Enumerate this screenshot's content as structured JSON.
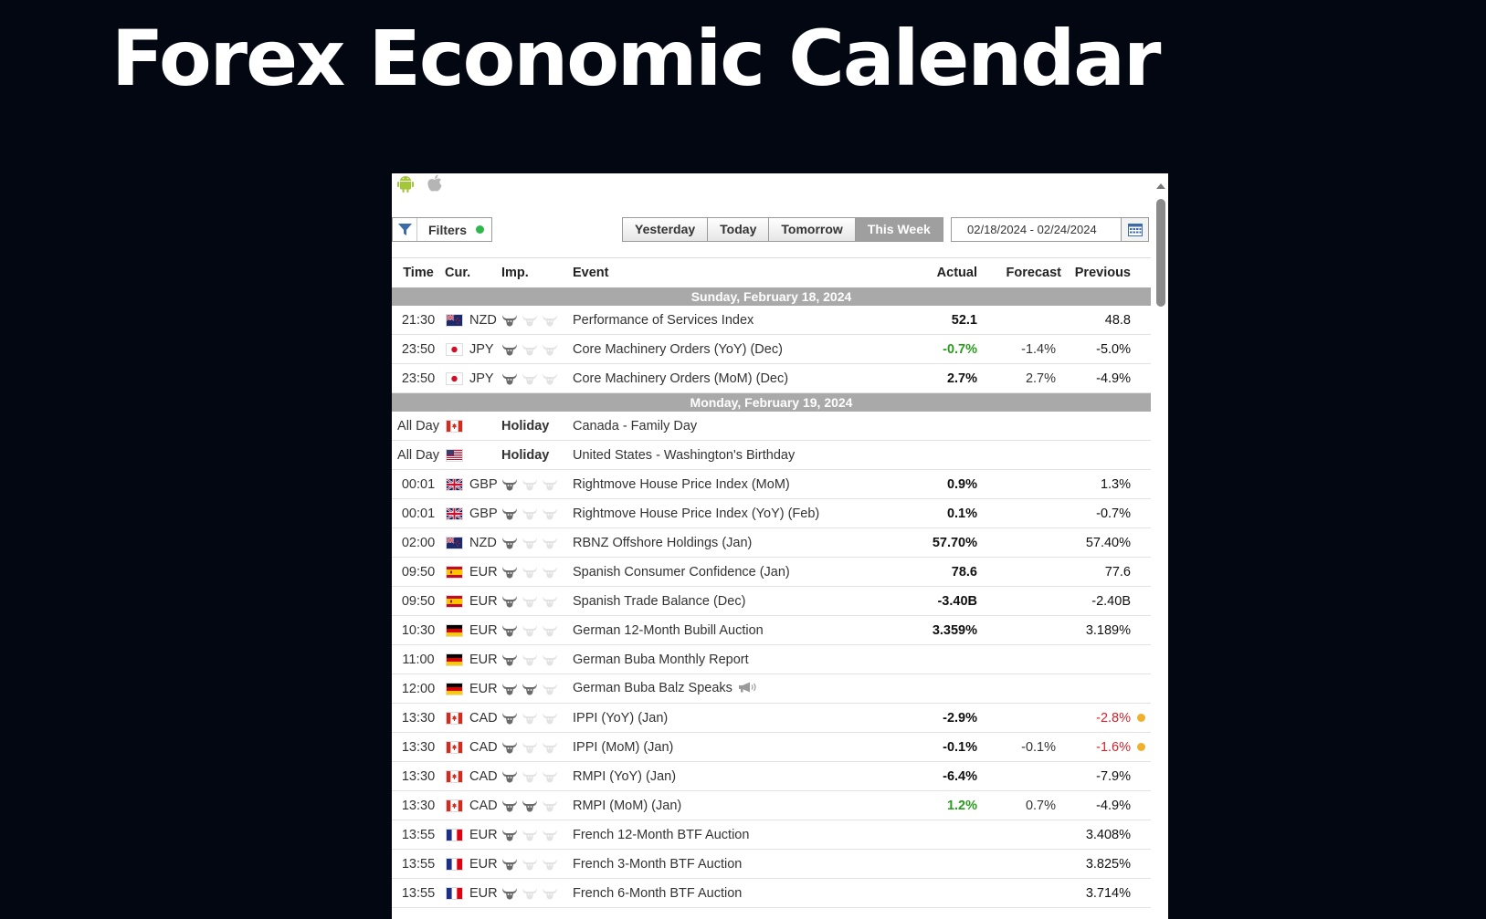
{
  "page": {
    "title": "Forex Economic Calendar"
  },
  "colors": {
    "positive": "#2a9d1e",
    "negative": "#d9232a",
    "neutral": "#111111",
    "alert_dot": "#f0b02c",
    "filter_dot": "#2cb84a"
  },
  "toolbar": {
    "filters_label": "Filters",
    "tabs": [
      {
        "label": "Yesterday",
        "active": false
      },
      {
        "label": "Today",
        "active": false
      },
      {
        "label": "Tomorrow",
        "active": false
      },
      {
        "label": "This Week",
        "active": true
      }
    ],
    "date_range": "02/18/2024 - 02/24/2024"
  },
  "table": {
    "headers": {
      "time": "Time",
      "currency": "Cur.",
      "importance": "Imp.",
      "event": "Event",
      "actual": "Actual",
      "forecast": "Forecast",
      "previous": "Previous"
    },
    "rows": [
      {
        "type": "day",
        "label": "Sunday, February 18, 2024"
      },
      {
        "time": "21:30",
        "flag": "nz",
        "currency": "NZD",
        "imp": 1,
        "event": "Performance of Services Index",
        "actual": "52.1",
        "actual_color": "neutral",
        "forecast": "",
        "previous": "48.8",
        "previous_color": "neutral"
      },
      {
        "time": "23:50",
        "flag": "jp",
        "currency": "JPY",
        "imp": 1,
        "event": "Core Machinery Orders (YoY) (Dec)",
        "actual": "-0.7%",
        "actual_color": "positive",
        "forecast": "-1.4%",
        "previous": "-5.0%",
        "previous_color": "neutral"
      },
      {
        "time": "23:50",
        "flag": "jp",
        "currency": "JPY",
        "imp": 1,
        "event": "Core Machinery Orders (MoM) (Dec)",
        "actual": "2.7%",
        "actual_color": "neutral",
        "forecast": "2.7%",
        "previous": "-4.9%",
        "previous_color": "neutral"
      },
      {
        "type": "day",
        "label": "Monday, February 19, 2024"
      },
      {
        "time": "All Day",
        "flag": "ca",
        "currency": "",
        "holiday": "Holiday",
        "event": "Canada - Family Day",
        "actual": "",
        "forecast": "",
        "previous": ""
      },
      {
        "time": "All Day",
        "flag": "us",
        "currency": "",
        "holiday": "Holiday",
        "event": "United States - Washington's Birthday",
        "actual": "",
        "forecast": "",
        "previous": ""
      },
      {
        "time": "00:01",
        "flag": "gb",
        "currency": "GBP",
        "imp": 1,
        "event": "Rightmove House Price Index (MoM)",
        "actual": "0.9%",
        "actual_color": "neutral",
        "forecast": "",
        "previous": "1.3%",
        "previous_color": "neutral"
      },
      {
        "time": "00:01",
        "flag": "gb",
        "currency": "GBP",
        "imp": 1,
        "event": "Rightmove House Price Index (YoY) (Feb)",
        "actual": "0.1%",
        "actual_color": "neutral",
        "forecast": "",
        "previous": "-0.7%",
        "previous_color": "neutral"
      },
      {
        "time": "02:00",
        "flag": "nz",
        "currency": "NZD",
        "imp": 1,
        "event": "RBNZ Offshore Holdings (Jan)",
        "actual": "57.70%",
        "actual_color": "neutral",
        "forecast": "",
        "previous": "57.40%",
        "previous_color": "neutral"
      },
      {
        "time": "09:50",
        "flag": "es",
        "currency": "EUR",
        "imp": 1,
        "event": "Spanish Consumer Confidence (Jan)",
        "actual": "78.6",
        "actual_color": "neutral",
        "forecast": "",
        "previous": "77.6",
        "previous_color": "neutral"
      },
      {
        "time": "09:50",
        "flag": "es",
        "currency": "EUR",
        "imp": 1,
        "event": "Spanish Trade Balance (Dec)",
        "actual": "-3.40B",
        "actual_color": "neutral",
        "forecast": "",
        "previous": "-2.40B",
        "previous_color": "neutral"
      },
      {
        "time": "10:30",
        "flag": "de",
        "currency": "EUR",
        "imp": 1,
        "event": "German 12-Month Bubill Auction",
        "actual": "3.359%",
        "actual_color": "neutral",
        "forecast": "",
        "previous": "3.189%",
        "previous_color": "neutral"
      },
      {
        "time": "11:00",
        "flag": "de",
        "currency": "EUR",
        "imp": 1,
        "event": "German Buba Monthly Report",
        "actual": "",
        "forecast": "",
        "previous": ""
      },
      {
        "time": "12:00",
        "flag": "de",
        "currency": "EUR",
        "imp": 2,
        "event": "German Buba Balz Speaks",
        "speech": true,
        "actual": "",
        "forecast": "",
        "previous": ""
      },
      {
        "time": "13:30",
        "flag": "ca",
        "currency": "CAD",
        "imp": 1,
        "event": "IPPI (YoY) (Jan)",
        "actual": "-2.9%",
        "actual_color": "neutral",
        "forecast": "",
        "previous": "-2.8%",
        "previous_color": "negative",
        "alert": true
      },
      {
        "time": "13:30",
        "flag": "ca",
        "currency": "CAD",
        "imp": 1,
        "event": "IPPI (MoM) (Jan)",
        "actual": "-0.1%",
        "actual_color": "neutral",
        "forecast": "-0.1%",
        "previous": "-1.6%",
        "previous_color": "negative",
        "alert": true
      },
      {
        "time": "13:30",
        "flag": "ca",
        "currency": "CAD",
        "imp": 1,
        "event": "RMPI (YoY) (Jan)",
        "actual": "-6.4%",
        "actual_color": "neutral",
        "forecast": "",
        "previous": "-7.9%",
        "previous_color": "neutral"
      },
      {
        "time": "13:30",
        "flag": "ca",
        "currency": "CAD",
        "imp": 2,
        "event": "RMPI (MoM) (Jan)",
        "actual": "1.2%",
        "actual_color": "positive",
        "forecast": "0.7%",
        "previous": "-4.9%",
        "previous_color": "neutral"
      },
      {
        "time": "13:55",
        "flag": "fr",
        "currency": "EUR",
        "imp": 1,
        "event": "French 12-Month BTF Auction",
        "actual": "",
        "forecast": "",
        "previous": "3.408%",
        "previous_color": "neutral"
      },
      {
        "time": "13:55",
        "flag": "fr",
        "currency": "EUR",
        "imp": 1,
        "event": "French 3-Month BTF Auction",
        "actual": "",
        "forecast": "",
        "previous": "3.825%",
        "previous_color": "neutral"
      },
      {
        "time": "13:55",
        "flag": "fr",
        "currency": "EUR",
        "imp": 1,
        "event": "French 6-Month BTF Auction",
        "actual": "",
        "forecast": "",
        "previous": "3.714%",
        "previous_color": "neutral"
      }
    ]
  }
}
